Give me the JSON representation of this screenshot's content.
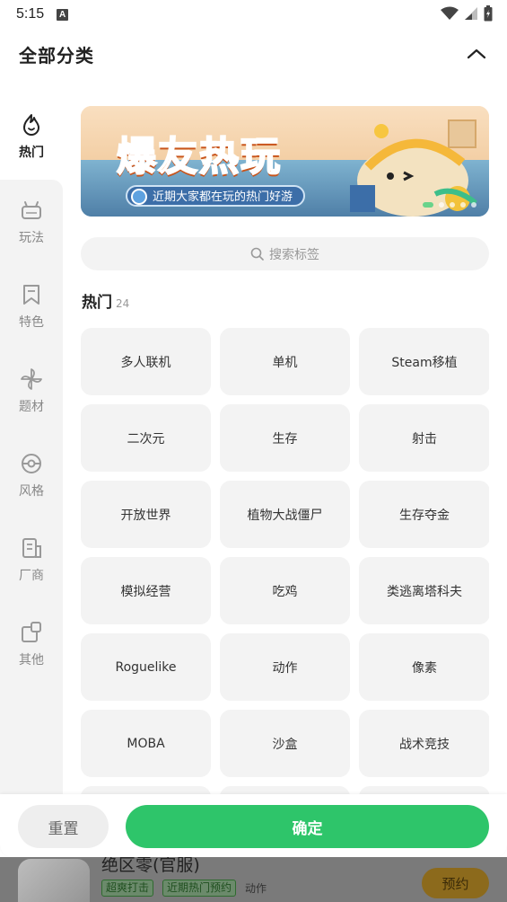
{
  "status_bar": {
    "time": "5:15",
    "notification_badge": "A"
  },
  "header": {
    "title": "全部分类"
  },
  "sidebar": {
    "items": [
      {
        "label": "热门",
        "icon": "flame-icon",
        "active": true
      },
      {
        "label": "玩法",
        "icon": "gamepad-icon",
        "active": false
      },
      {
        "label": "特色",
        "icon": "bookmark-icon",
        "active": false
      },
      {
        "label": "题材",
        "icon": "pinwheel-icon",
        "active": false
      },
      {
        "label": "风格",
        "icon": "pokeball-icon",
        "active": false
      },
      {
        "label": "厂商",
        "icon": "building-icon",
        "active": false
      },
      {
        "label": "其他",
        "icon": "cards-icon",
        "active": false
      }
    ]
  },
  "banner": {
    "headline": "爆友热玩",
    "subtitle": "近期大家都在玩的热门好游"
  },
  "search": {
    "placeholder": "搜索标签"
  },
  "section": {
    "name": "热门",
    "count": "24"
  },
  "tags": [
    "多人联机",
    "单机",
    "Steam移植",
    "二次元",
    "生存",
    "射击",
    "开放世界",
    "植物大战僵尸",
    "生存夺金",
    "模拟经营",
    "吃鸡",
    "类逃离塔科夫",
    "Roguelike",
    "动作",
    "像素",
    "MOBA",
    "沙盒",
    "战术竞技",
    "",
    "",
    ""
  ],
  "footer": {
    "reset_label": "重置",
    "confirm_label": "确定"
  },
  "background_app": {
    "game_title": "绝区零(官服)",
    "badge_1": "超爽打击",
    "badge_2": "近期热门预约",
    "genre": "动作",
    "reserve_label": "预约"
  },
  "colors": {
    "accent": "#2ec56a",
    "panel": "#f3f3f3",
    "banner_orange": "#ff8a2a"
  }
}
